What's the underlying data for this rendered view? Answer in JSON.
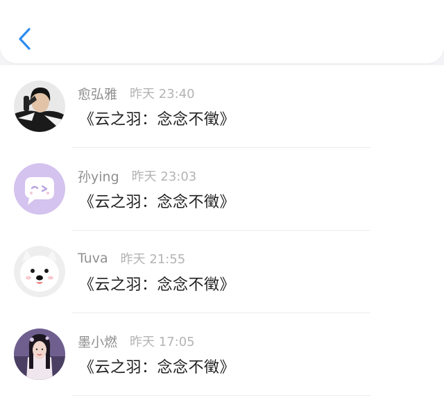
{
  "header": {
    "back_icon": "chevron-left-icon",
    "accent_color": "#2d8cf0"
  },
  "messages": [
    {
      "name": "愈弘雅",
      "time": "昨天 23:40",
      "content": "《云之羽：念念不徵》",
      "avatar": "person-avatar"
    },
    {
      "name": "孙ying",
      "time": "昨天 23:03",
      "content": "《云之羽：念念不徵》",
      "avatar": "purple-chat-avatar"
    },
    {
      "name": "Tuva",
      "time": "昨天 21:55",
      "content": "《云之羽：念念不徵》",
      "avatar": "dog-avatar"
    },
    {
      "name": "墨小燃",
      "time": "昨天 17:05",
      "content": "《云之羽：念念不徵》",
      "avatar": "woman-avatar"
    }
  ]
}
